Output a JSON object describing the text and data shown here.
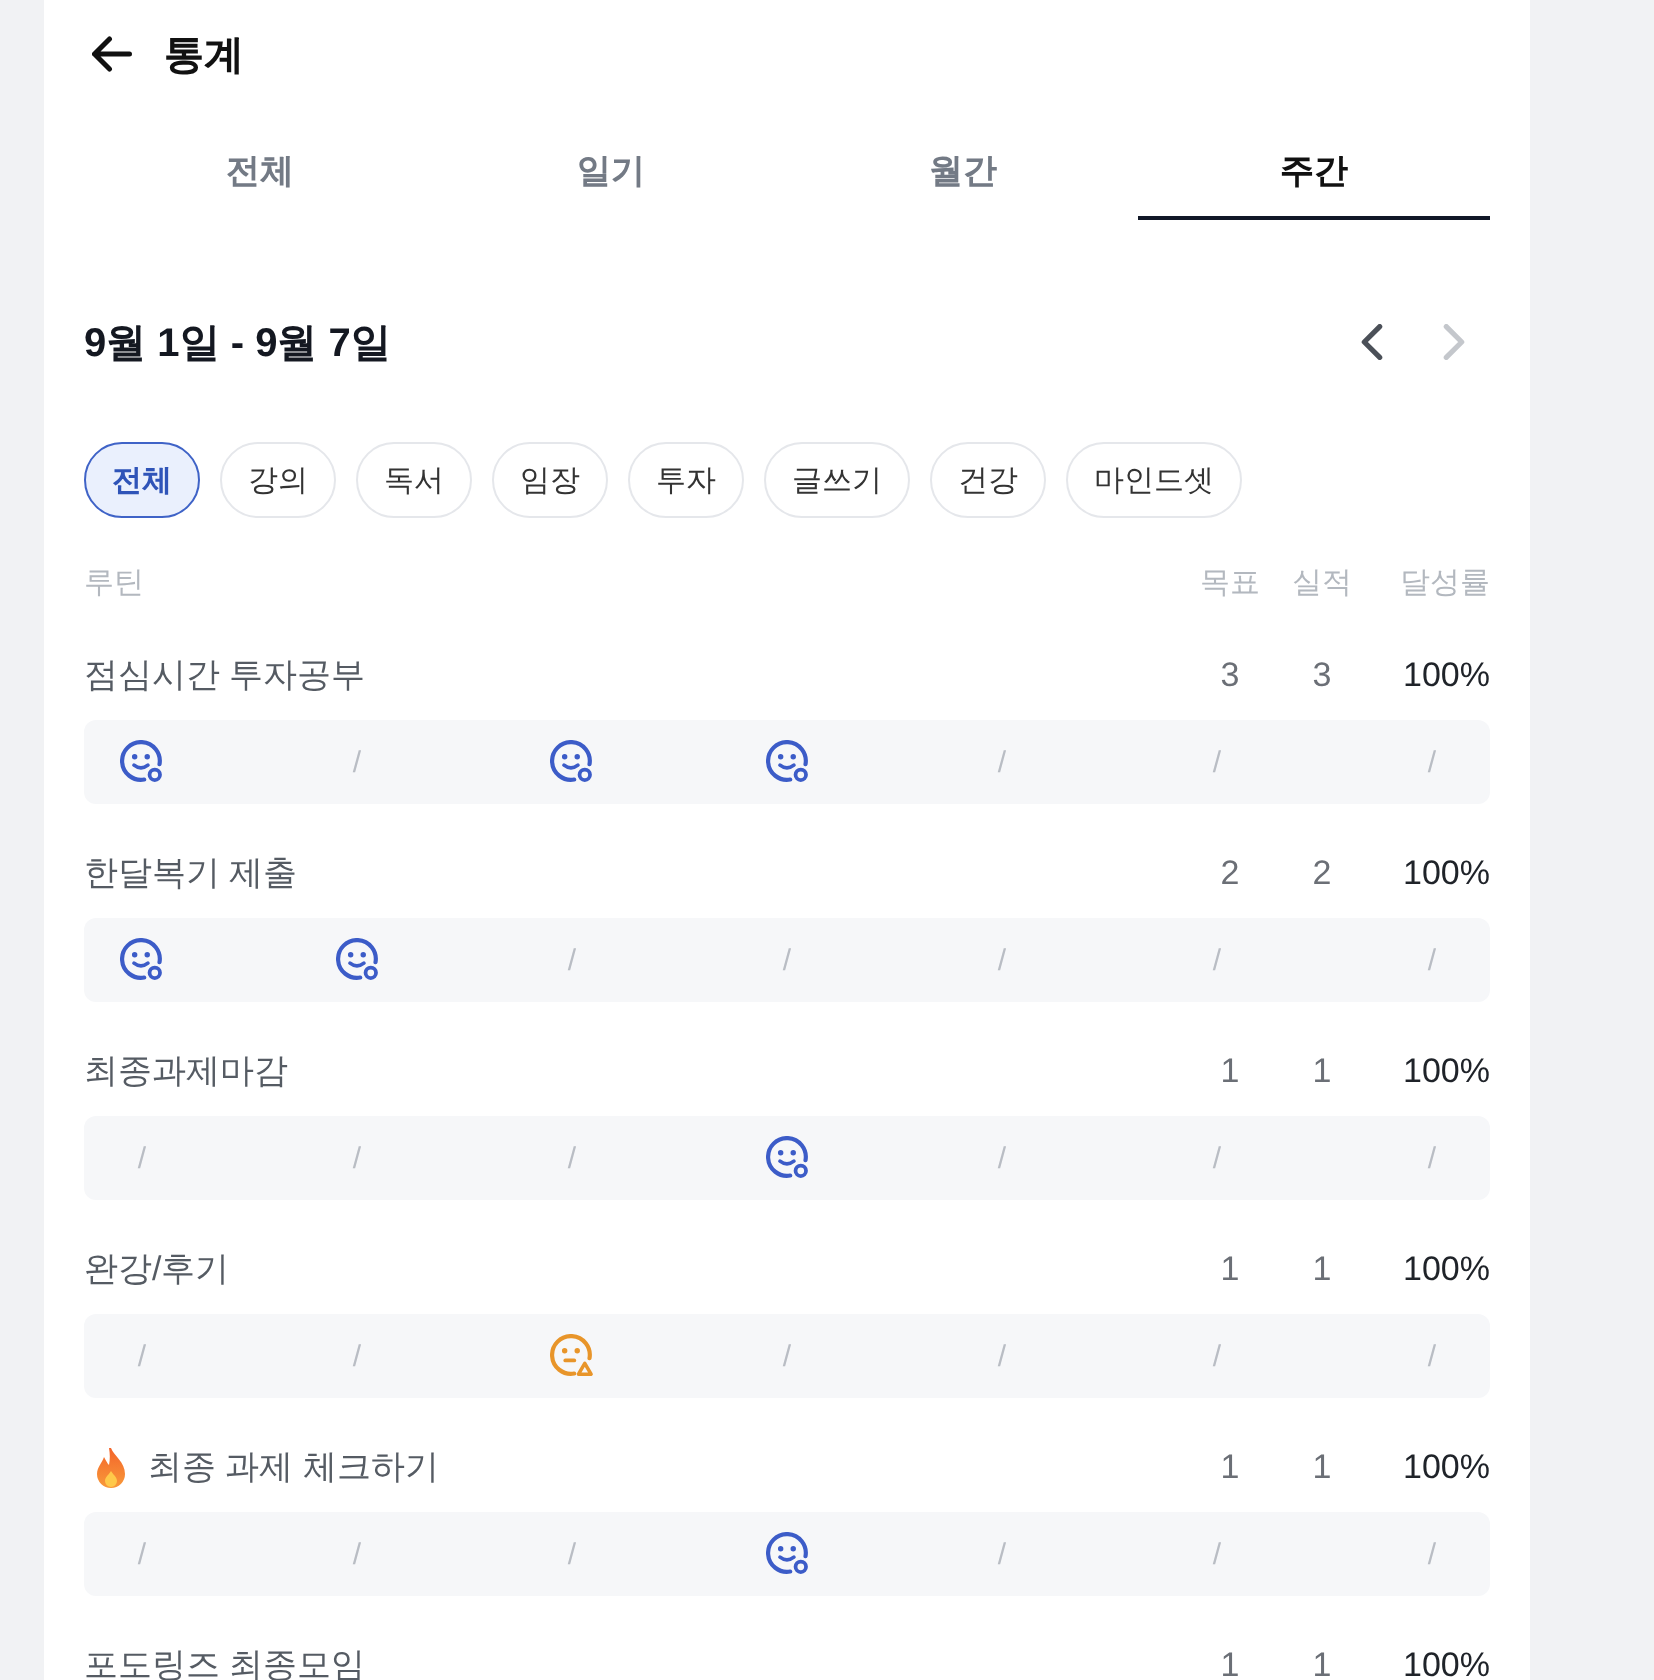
{
  "header": {
    "title": "통계"
  },
  "tabs": [
    {
      "label": "전체",
      "selected": false
    },
    {
      "label": "일기",
      "selected": false
    },
    {
      "label": "월간",
      "selected": false
    },
    {
      "label": "주간",
      "selected": true
    }
  ],
  "period": {
    "label": "9월 1일 - 9월 7일",
    "prev": {
      "disabled": false
    },
    "next": {
      "disabled": true
    }
  },
  "filters": [
    {
      "label": "전체",
      "selected": true
    },
    {
      "label": "강의",
      "selected": false
    },
    {
      "label": "독서",
      "selected": false
    },
    {
      "label": "임장",
      "selected": false
    },
    {
      "label": "투자",
      "selected": false
    },
    {
      "label": "글쓰기",
      "selected": false
    },
    {
      "label": "건강",
      "selected": false
    },
    {
      "label": "마인드셋",
      "selected": false
    }
  ],
  "table": {
    "columns": [
      "루틴",
      "목표",
      "실적",
      "달성률"
    ],
    "rows": [
      {
        "name": "점심시간 투자공부",
        "kind": "plain",
        "goal": "3",
        "actual": "3",
        "rate": "100%",
        "days": [
          {
            "kind": "done"
          },
          {
            "kind": "empty",
            "mark": "/"
          },
          {
            "kind": "done"
          },
          {
            "kind": "done"
          },
          {
            "kind": "empty",
            "mark": "/"
          },
          {
            "kind": "empty",
            "mark": "/"
          },
          {
            "kind": "empty",
            "mark": "/"
          }
        ]
      },
      {
        "name": "한달복기 제출",
        "kind": "plain",
        "goal": "2",
        "actual": "2",
        "rate": "100%",
        "days": [
          {
            "kind": "done"
          },
          {
            "kind": "done"
          },
          {
            "kind": "empty",
            "mark": "/"
          },
          {
            "kind": "empty",
            "mark": "/"
          },
          {
            "kind": "empty",
            "mark": "/"
          },
          {
            "kind": "empty",
            "mark": "/"
          },
          {
            "kind": "empty",
            "mark": "/"
          }
        ]
      },
      {
        "name": "최종과제마감",
        "kind": "plain",
        "goal": "1",
        "actual": "1",
        "rate": "100%",
        "days": [
          {
            "kind": "empty",
            "mark": "/"
          },
          {
            "kind": "empty",
            "mark": "/"
          },
          {
            "kind": "empty",
            "mark": "/"
          },
          {
            "kind": "done"
          },
          {
            "kind": "empty",
            "mark": "/"
          },
          {
            "kind": "empty",
            "mark": "/"
          },
          {
            "kind": "empty",
            "mark": "/"
          }
        ]
      },
      {
        "name": "완강/후기",
        "kind": "plain",
        "goal": "1",
        "actual": "1",
        "rate": "100%",
        "days": [
          {
            "kind": "empty",
            "mark": "/"
          },
          {
            "kind": "empty",
            "mark": "/"
          },
          {
            "kind": "warning"
          },
          {
            "kind": "empty",
            "mark": "/"
          },
          {
            "kind": "empty",
            "mark": "/"
          },
          {
            "kind": "empty",
            "mark": "/"
          },
          {
            "kind": "empty",
            "mark": "/"
          }
        ]
      },
      {
        "name": "최종 과제 체크하기",
        "kind": "highlighted",
        "goal": "1",
        "actual": "1",
        "rate": "100%",
        "days": [
          {
            "kind": "empty",
            "mark": "/"
          },
          {
            "kind": "empty",
            "mark": "/"
          },
          {
            "kind": "empty",
            "mark": "/"
          },
          {
            "kind": "done"
          },
          {
            "kind": "empty",
            "mark": "/"
          },
          {
            "kind": "empty",
            "mark": "/"
          },
          {
            "kind": "empty",
            "mark": "/"
          }
        ]
      },
      {
        "name": "포도링즈 최종모임",
        "kind": "plain",
        "goal": "1",
        "actual": "1",
        "rate": "100%"
      }
    ]
  }
}
